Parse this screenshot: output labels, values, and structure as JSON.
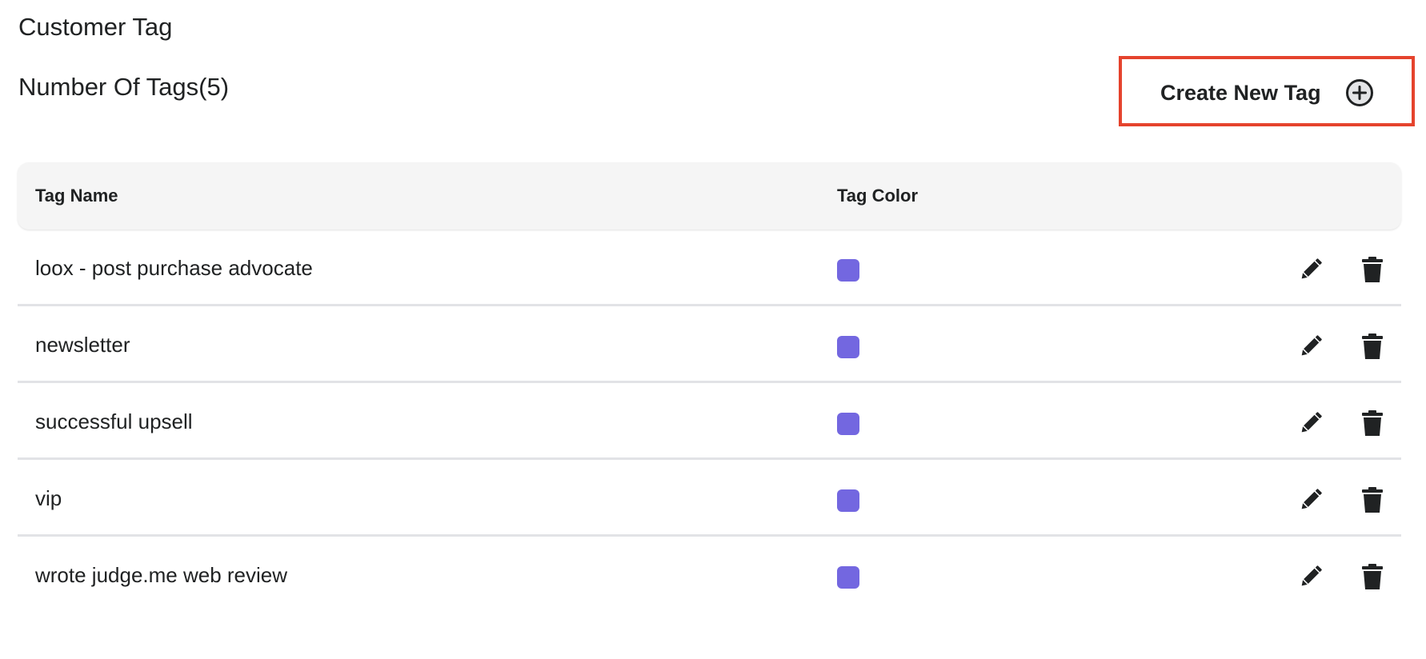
{
  "page": {
    "title": "Customer Tag",
    "count_label": "Number Of Tags(5)"
  },
  "toolbar": {
    "create_label": "Create New Tag",
    "create_icon": "plus-circle-icon",
    "highlight_color": "#e5432d"
  },
  "table": {
    "headers": {
      "name": "Tag Name",
      "color": "Tag Color"
    },
    "rows": [
      {
        "name": "loox - post purchase advocate",
        "color": "#7367e0"
      },
      {
        "name": "newsletter",
        "color": "#7367e0"
      },
      {
        "name": "successful upsell",
        "color": "#7367e0"
      },
      {
        "name": "vip",
        "color": "#7367e0"
      },
      {
        "name": "wrote judge.me web review",
        "color": "#7367e0"
      }
    ],
    "row_actions": {
      "edit_icon": "pencil-icon",
      "delete_icon": "trash-icon"
    }
  }
}
